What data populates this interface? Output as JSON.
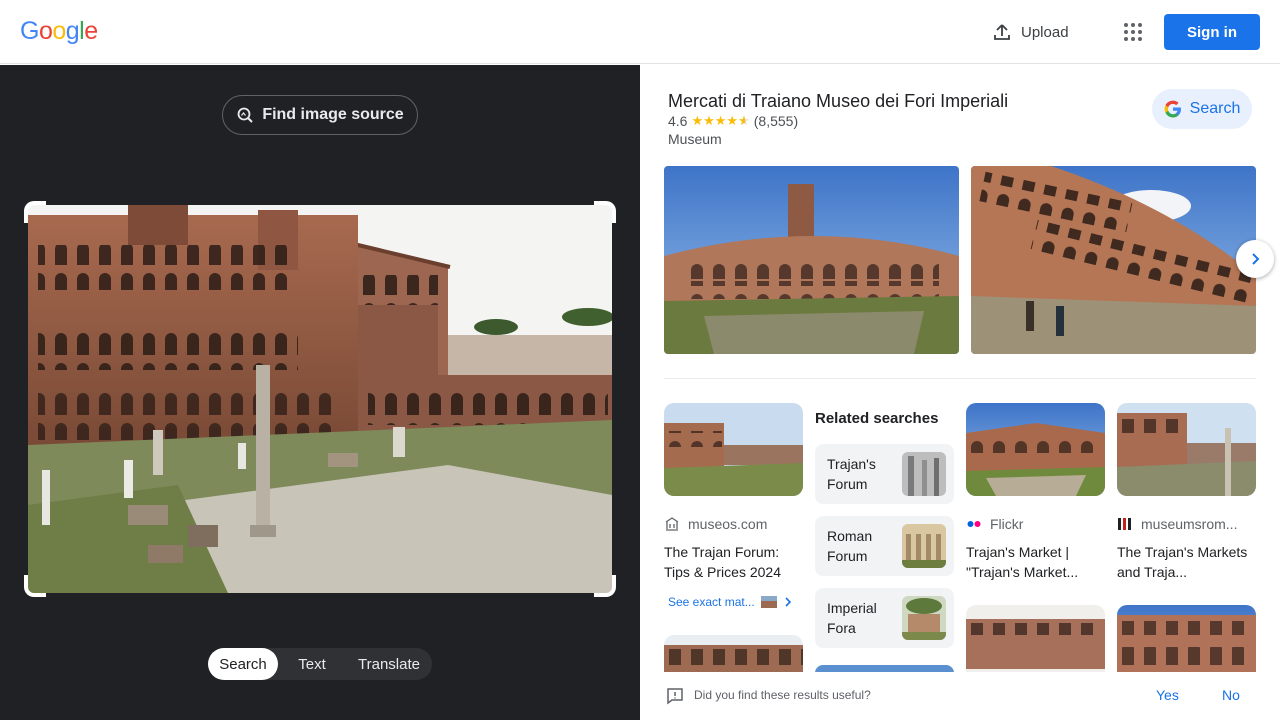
{
  "header": {
    "logo_letters": [
      {
        "char": "G",
        "color": "#4285F4"
      },
      {
        "char": "o",
        "color": "#EA4335"
      },
      {
        "char": "o",
        "color": "#FBBC05"
      },
      {
        "char": "g",
        "color": "#4285F4"
      },
      {
        "char": "l",
        "color": "#34A853"
      },
      {
        "char": "e",
        "color": "#EA4335"
      }
    ],
    "upload_label": "Upload",
    "upload_icon": "upload-icon",
    "apps_icon": "apps-grid-icon",
    "sign_in_label": "Sign in"
  },
  "lens": {
    "find_source_label": "Find image source",
    "modes": [
      {
        "label": "Search",
        "active": true
      },
      {
        "label": "Text",
        "active": false
      },
      {
        "label": "Translate",
        "active": false
      }
    ]
  },
  "knowledge_panel": {
    "title": "Mercati di Traiano Museo dei Fori Imperiali",
    "rating": "4.6",
    "stars_display": "★★★★☆",
    "stars_value": 4.6,
    "reviews": "(8,555)",
    "type": "Museum",
    "search_label": "Search"
  },
  "results": [
    {
      "source": "museos.com",
      "title": "The Trajan Forum: Tips & Prices 2024"
    },
    {
      "source": "Flickr",
      "title": "Trajan's Market | \"Trajan's Market..."
    },
    {
      "source": "museumsrom...",
      "title": "The Trajan's Markets and Traja..."
    }
  ],
  "exact_matches_label": "See exact mat...",
  "related": {
    "heading": "Related searches",
    "items": [
      {
        "label": "Trajan's Forum"
      },
      {
        "label": "Roman Forum"
      },
      {
        "label": "Imperial Fora"
      }
    ]
  },
  "feedback": {
    "question": "Did you find these results useful?",
    "yes": "Yes",
    "no": "No"
  },
  "colors": {
    "accent": "#1a73e8",
    "dark_panel": "#202124",
    "star": "#fbbc04"
  }
}
